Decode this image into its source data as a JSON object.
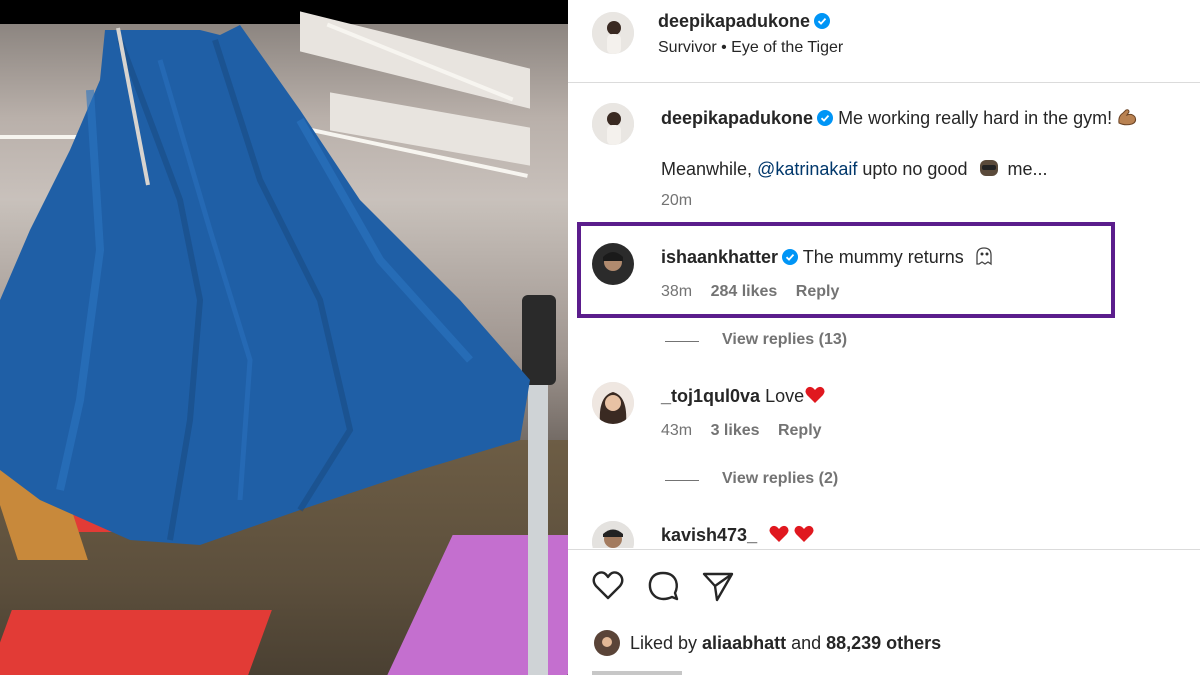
{
  "post": {
    "username": "deepikapadukone",
    "audio": "Survivor • Eye of the Tiger"
  },
  "caption": {
    "username": "deepikapadukone",
    "text_line1": "Me working really hard in the gym!",
    "text_line2_prefix": "Meanwhile, ",
    "mention": "@katrinakaif",
    "text_line2_suffix": " upto no good",
    "text_line2_more": " me...",
    "time": "20m"
  },
  "comments": [
    {
      "username": "ishaankhatter",
      "text": "The mummy returns",
      "time": "38m",
      "likes": "284 likes",
      "reply": "Reply",
      "view_replies": "View replies (13)",
      "verified": true,
      "highlighted": true
    },
    {
      "username": "_toj1qul0va",
      "text": "Love",
      "time": "43m",
      "likes": "3 likes",
      "reply": "Reply",
      "view_replies": "View replies (2)",
      "verified": false
    },
    {
      "username": "kavish473_",
      "text": "",
      "verified": false
    }
  ],
  "actions": {
    "like_icon": "heart-icon",
    "comment_icon": "comment-bubble-icon",
    "share_icon": "paper-plane-icon"
  },
  "likes_summary": {
    "prefix": "Liked by ",
    "user": "aliaabhatt",
    "connector": " and ",
    "others": "88,239 others"
  },
  "colors": {
    "verified_blue": "#0095f6",
    "highlight_border": "#5b1d8c",
    "heart_red": "#e0181f",
    "mention_blue": "#00376b",
    "meta_gray": "#737373"
  }
}
